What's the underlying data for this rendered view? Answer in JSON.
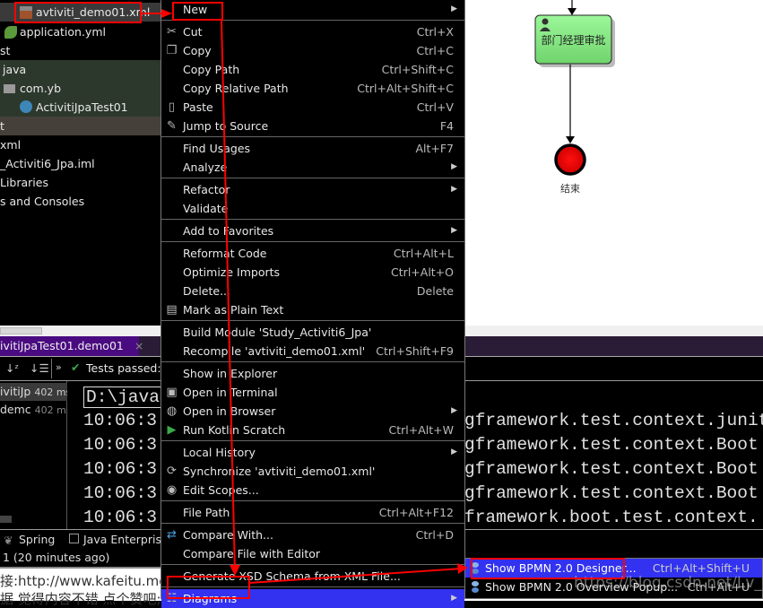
{
  "project_tree": {
    "items": [
      {
        "label": "avtiviti_demo01.xml",
        "icon": "xml-file-icon"
      },
      {
        "label": "application.yml",
        "icon": "spring-config-icon"
      },
      {
        "label": "st"
      },
      {
        "label": "java"
      },
      {
        "label": "com.yb",
        "icon": "package-icon"
      },
      {
        "label": "ActivitiJpaTest01",
        "icon": "java-class-icon"
      },
      {
        "label": "t"
      },
      {
        "label": "xml"
      },
      {
        "label": "_Activiti6_Jpa.iml"
      },
      {
        "label": "Libraries"
      },
      {
        "label": "s and Consoles"
      }
    ]
  },
  "diagram": {
    "task_label": "部门经理审批",
    "end_label": "结束",
    "task_color": "#8ee68a",
    "end_color": "#e00000"
  },
  "run_panel": {
    "tab_label": "ivitiJpaTest01.demo01",
    "tests_passed": "Tests passed:",
    "test_items": [
      {
        "name": "ivitiJp",
        "time": "402 ms"
      },
      {
        "name": "demc",
        "time": "402 ms"
      }
    ],
    "console_lines": [
      "D:\\java",
      "10:06:3",
      "10:06:3",
      "10:06:3",
      "10:06:3",
      "10:06:3"
    ],
    "console_right": [
      "",
      "gframework.test.context.junit",
      "gframework.test.context.Boot",
      "gframework.test.context.Boot",
      "gframework.test.context.Boot",
      "framework.boot.test.context."
    ]
  },
  "bottom_tools": {
    "spring": "Spring",
    "java_enterprise": "Java Enterprise"
  },
  "status": "1 (20 minutes ago)",
  "web_text": {
    "line1_prefix": "接:http://www.kafeitu.me/",
    "line1_red": "ac",
    "line2": "据 觉得内容不错 点个赞吧;想M"
  },
  "context_menu": {
    "items": [
      {
        "label": "New",
        "arrow": true
      },
      {
        "sep": true
      },
      {
        "label": "Cut",
        "shortcut": "Ctrl+X",
        "icon": "scissors-icon"
      },
      {
        "label": "Copy",
        "shortcut": "Ctrl+C",
        "icon": "copy-icon"
      },
      {
        "label": "Copy Path",
        "shortcut": "Ctrl+Shift+C"
      },
      {
        "label": "Copy Relative Path",
        "shortcut": "Ctrl+Alt+Shift+C"
      },
      {
        "label": "Paste",
        "shortcut": "Ctrl+V",
        "icon": "paste-icon"
      },
      {
        "label": "Jump to Source",
        "shortcut": "F4",
        "icon": "pencil-icon"
      },
      {
        "sep": true
      },
      {
        "label": "Find Usages",
        "shortcut": "Alt+F7"
      },
      {
        "label": "Analyze",
        "arrow": true
      },
      {
        "sep": true
      },
      {
        "label": "Refactor",
        "arrow": true
      },
      {
        "label": "Validate"
      },
      {
        "sep": true
      },
      {
        "label": "Add to Favorites",
        "arrow": true
      },
      {
        "sep": true
      },
      {
        "label": "Reformat Code",
        "shortcut": "Ctrl+Alt+L"
      },
      {
        "label": "Optimize Imports",
        "shortcut": "Ctrl+Alt+O"
      },
      {
        "label": "Delete...",
        "shortcut": "Delete"
      },
      {
        "label": "Mark as Plain Text",
        "icon": "plain-text-icon"
      },
      {
        "sep": true
      },
      {
        "label": "Build Module 'Study_Activiti6_Jpa'"
      },
      {
        "label": "Recompile 'avtiviti_demo01.xml'",
        "shortcut": "Ctrl+Shift+F9"
      },
      {
        "sep": true
      },
      {
        "label": "Show in Explorer"
      },
      {
        "label": "Open in Terminal",
        "icon": "terminal-icon"
      },
      {
        "label": "Open in Browser",
        "arrow": true,
        "icon": "globe-icon"
      },
      {
        "label": "Run Kotlin Scratch",
        "shortcut": "Ctrl+Alt+W",
        "icon": "run-icon"
      },
      {
        "sep": true
      },
      {
        "label": "Local History",
        "arrow": true
      },
      {
        "label": "Synchronize 'avtiviti_demo01.xml'",
        "icon": "sync-icon"
      },
      {
        "label": "Edit Scopes...",
        "icon": "scope-icon"
      },
      {
        "sep": true
      },
      {
        "label": "File Path",
        "shortcut": "Ctrl+Alt+F12"
      },
      {
        "sep": true
      },
      {
        "label": "Compare With...",
        "shortcut": "Ctrl+D",
        "icon": "compare-icon"
      },
      {
        "label": "Compare File with Editor"
      },
      {
        "sep": true
      },
      {
        "label": "Generate XSD Schema from XML File..."
      },
      {
        "sep": true
      },
      {
        "label": "Diagrams",
        "arrow": true,
        "icon": "diagram-icon",
        "selected": true
      }
    ]
  },
  "submenu": {
    "items": [
      {
        "label": "Show BPMN 2.0 Designer...",
        "shortcut": "Ctrl+Alt+Shift+U",
        "selected": true
      },
      {
        "label": "Show BPMN 2.0 Overview Popup...",
        "shortcut": "Ctrl+Alt+U"
      }
    ]
  },
  "watermark": "https://blog.csdn.net/Lv_vl",
  "colors": {
    "menu_highlight": "#3232f0",
    "annotation": "#ff0000",
    "tab_active": "#4a0b80"
  }
}
